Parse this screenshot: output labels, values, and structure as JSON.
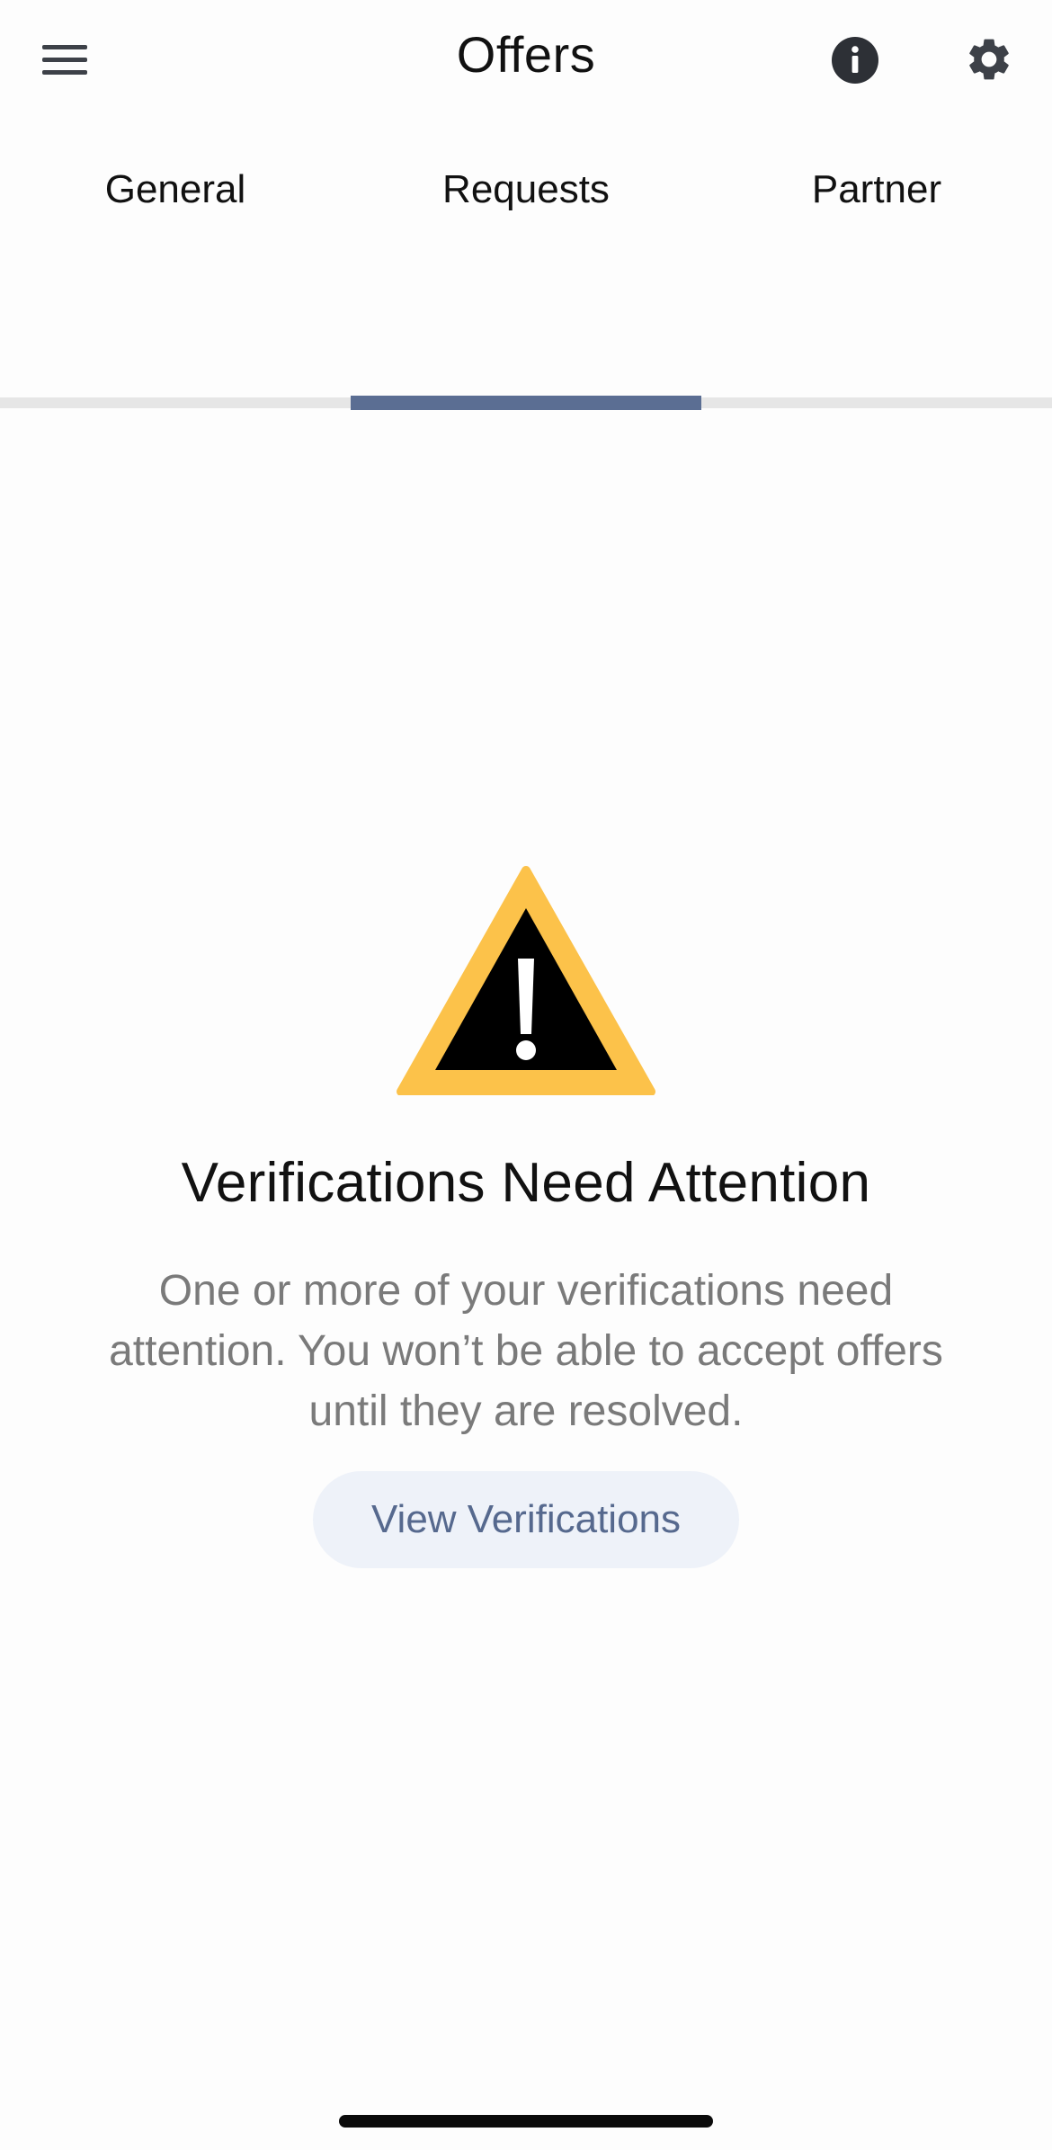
{
  "header": {
    "title": "Offers",
    "menu_icon": "hamburger-menu-icon",
    "info_icon": "info-icon",
    "settings_icon": "gear-icon"
  },
  "tabs": [
    {
      "label": "General",
      "active": false
    },
    {
      "label": "Requests",
      "active": true
    },
    {
      "label": "Partner",
      "active": false
    }
  ],
  "notice": {
    "icon": "warning-triangle-icon",
    "title": "Verifications Need Attention",
    "description": "One or more of your verifications need attention. You won’t be able to accept offers until they are resolved.",
    "button_label": "View Verifications"
  },
  "colors": {
    "tab_indicator": "#5b6e93",
    "warning_fill": "#fcc24a",
    "button_bg": "#eef2f9",
    "button_text": "#56698e"
  }
}
